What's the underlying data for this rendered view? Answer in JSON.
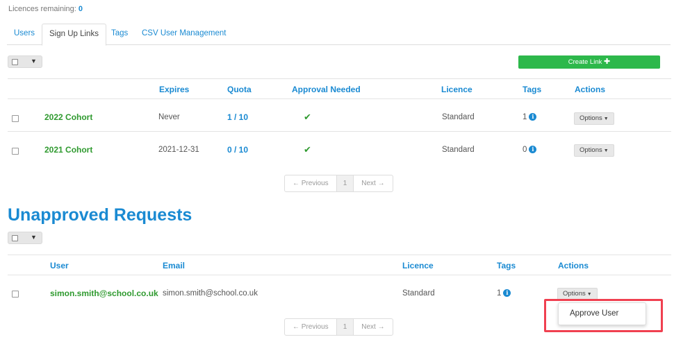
{
  "licences": {
    "label": "Licences remaining:",
    "value": "0"
  },
  "tabs": [
    {
      "label": "Users",
      "active": false
    },
    {
      "label": "Sign Up Links",
      "active": true
    },
    {
      "label": "Tags",
      "active": false
    },
    {
      "label": "CSV User Management",
      "active": false
    }
  ],
  "create_link": {
    "label": "Create Link",
    "icon": "plus-icon"
  },
  "links_table": {
    "headers": {
      "expires": "Expires",
      "quota": "Quota",
      "approval": "Approval Needed",
      "licence": "Licence",
      "tags": "Tags",
      "actions": "Actions"
    },
    "rows": [
      {
        "name": "2022 Cohort",
        "expires": "Never",
        "quota": "1 / 10",
        "approval": "✔",
        "licence": "Standard",
        "tags": "1",
        "options": "Options"
      },
      {
        "name": "2021 Cohort",
        "expires": "2021-12-31",
        "quota": "0 / 10",
        "approval": "✔",
        "licence": "Standard",
        "tags": "0",
        "options": "Options"
      }
    ]
  },
  "pagination": {
    "previous": "← Previous",
    "page": "1",
    "next": "Next →"
  },
  "unapproved": {
    "title": "Unapproved Requests",
    "headers": {
      "user": "User",
      "email": "Email",
      "licence": "Licence",
      "tags": "Tags",
      "actions": "Actions"
    },
    "rows": [
      {
        "user": "simon.smith@school.co.uk",
        "email": "simon.smith@school.co.uk",
        "licence": "Standard",
        "tags": "1",
        "options": "Options"
      }
    ],
    "dropdown": {
      "approve": "Approve User"
    }
  },
  "colors": {
    "accent": "#1a8ad2",
    "success": "#2db84b",
    "highlight": "#f04050"
  }
}
